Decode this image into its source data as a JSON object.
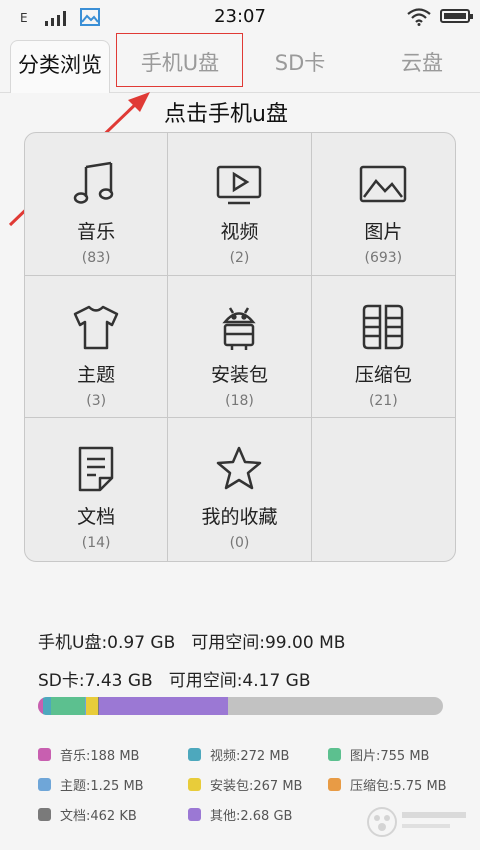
{
  "status_bar": {
    "network": "E",
    "time": "23:07",
    "battery_level": 1.0
  },
  "tabs": [
    {
      "label": "分类浏览",
      "active": true
    },
    {
      "label": "手机U盘",
      "active": false
    },
    {
      "label": "SD卡",
      "active": false
    },
    {
      "label": "云盘",
      "active": false
    }
  ],
  "annotation": {
    "text": "点击手机u盘",
    "color": "#e03a35"
  },
  "categories": [
    {
      "label": "音乐",
      "count": "(83)",
      "icon": "music-note-icon"
    },
    {
      "label": "视频",
      "count": "(2)",
      "icon": "video-icon"
    },
    {
      "label": "图片",
      "count": "(693)",
      "icon": "image-icon"
    },
    {
      "label": "主题",
      "count": "(3)",
      "icon": "tshirt-icon"
    },
    {
      "label": "安装包",
      "count": "(18)",
      "icon": "android-icon"
    },
    {
      "label": "压缩包",
      "count": "(21)",
      "icon": "archive-icon"
    },
    {
      "label": "文档",
      "count": "(14)",
      "icon": "document-icon"
    },
    {
      "label": "我的收藏",
      "count": "(0)",
      "icon": "star-icon"
    }
  ],
  "storage": {
    "phone": {
      "total": "手机U盘:0.97 GB",
      "free": "可用空间:99.00 MB"
    },
    "sd": {
      "total": "SD卡:7.43 GB",
      "free": "可用空间:4.17 GB"
    },
    "usage_bar": [
      {
        "name": "音乐",
        "fraction": 0.012,
        "color": "#c85fb0"
      },
      {
        "name": "视频",
        "fraction": 0.02,
        "color": "#4da8bd"
      },
      {
        "name": "图片",
        "fraction": 0.085,
        "color": "#5cc08f"
      },
      {
        "name": "主题",
        "fraction": 0.002,
        "color": "#6fa6d8"
      },
      {
        "name": "安装包",
        "fraction": 0.028,
        "color": "#e8cc3a"
      },
      {
        "name": "压缩包",
        "fraction": 0.002,
        "color": "#e89b45"
      },
      {
        "name": "文档",
        "fraction": 0.001,
        "color": "#7a7a7a"
      },
      {
        "name": "其他",
        "fraction": 0.32,
        "color": "#9b78d4"
      }
    ],
    "bar_background": "#c2c2c2"
  },
  "legend": [
    {
      "label": "音乐:188 MB",
      "color": "#c85fb0"
    },
    {
      "label": "视频:272 MB",
      "color": "#4da8bd"
    },
    {
      "label": "图片:755 MB",
      "color": "#5cc08f"
    },
    {
      "label": "主题:1.25 MB",
      "color": "#6fa6d8"
    },
    {
      "label": "安装包:267 MB",
      "color": "#e8cc3a"
    },
    {
      "label": "压缩包:5.75 MB",
      "color": "#e89b45"
    },
    {
      "label": "文档:462 KB",
      "color": "#7a7a7a"
    },
    {
      "label": "其他:2.68 GB",
      "color": "#9b78d4"
    }
  ]
}
